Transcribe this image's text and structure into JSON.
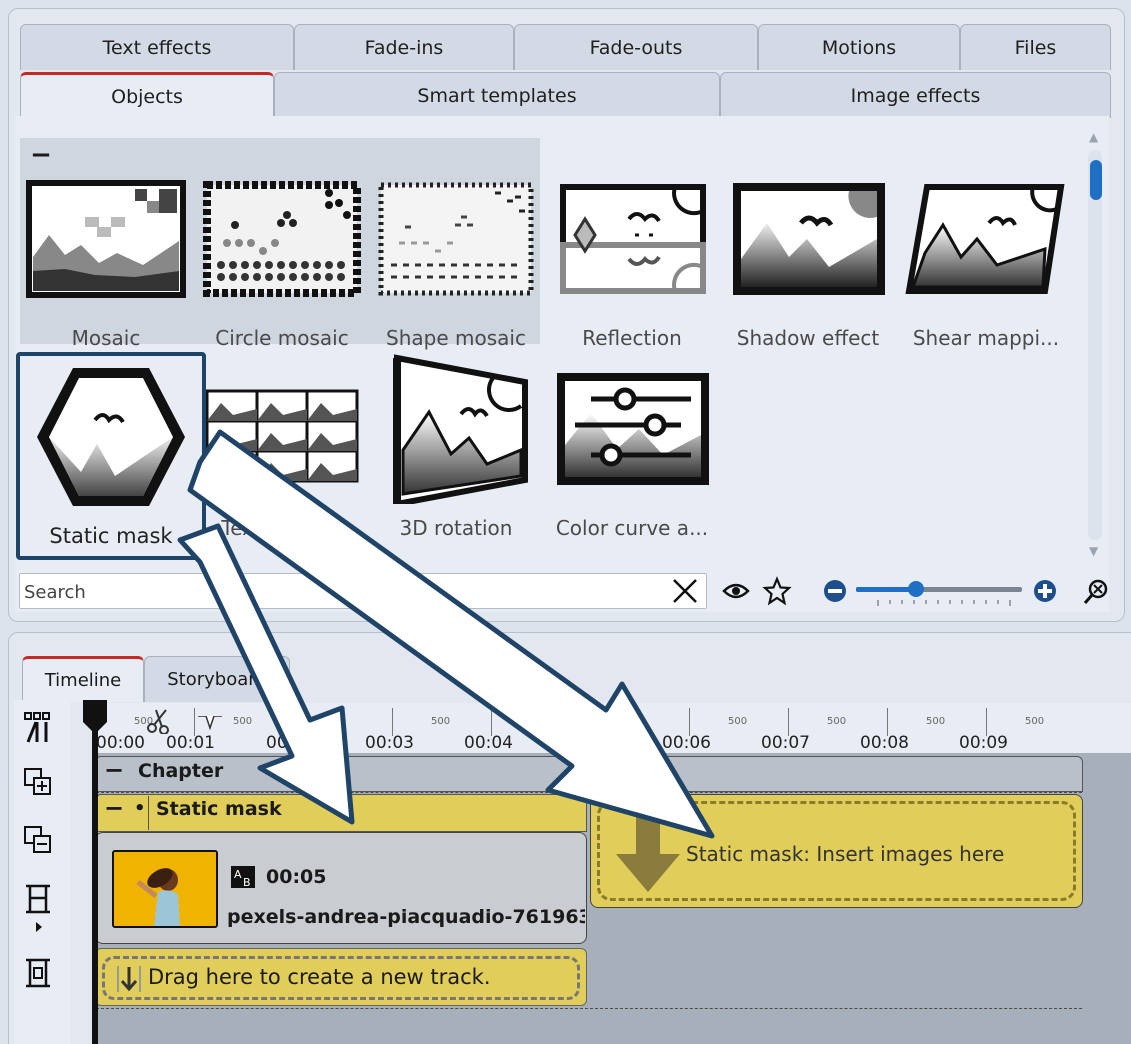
{
  "tabs_row1": [
    "Text effects",
    "Fade-ins",
    "Fade-outs",
    "Motions",
    "Files"
  ],
  "tabs_row2": [
    "Objects",
    "Smart templates",
    "Image effects"
  ],
  "effects": {
    "mosaic": "Mosaic",
    "circle_mosaic": "Circle mosaic",
    "shape_mosaic": "Shape mosaic",
    "reflection": "Reflection",
    "shadow_effect": "Shadow effect",
    "shear_mapping": "Shear mappi...",
    "static_mask": "Static mask",
    "texture_tiles": "Texture tiles",
    "rotation_3d": "3D rotation",
    "color_curve": "Color curve a..."
  },
  "group_collapse": "−",
  "search": {
    "placeholder": "Search"
  },
  "timeline_tabs": [
    "Timeline",
    "Storyboard"
  ],
  "ruler": {
    "labels": [
      "00:00",
      "00:01",
      "00:02",
      "00:03",
      "00:04",
      "00:05",
      "00:06",
      "00:07",
      "00:08",
      "00:09"
    ],
    "sub": "500"
  },
  "chapter": {
    "label": "Chapter",
    "toggle": "−"
  },
  "mask_track": {
    "label": "Static mask",
    "toggle": "−",
    "dot": "•"
  },
  "clip": {
    "duration": "00:05",
    "name": "pexels-andrea-piacquadio-761963"
  },
  "new_track": {
    "label": "Drag here to create a new track."
  },
  "insert_zone": {
    "label": "Static mask: Insert images here"
  },
  "colors": {
    "accent_blue": "#1f6fc4",
    "tab_active_red": "#c62828",
    "track_yellow": "#e0cd5a",
    "callout_border": "#1f4468"
  }
}
